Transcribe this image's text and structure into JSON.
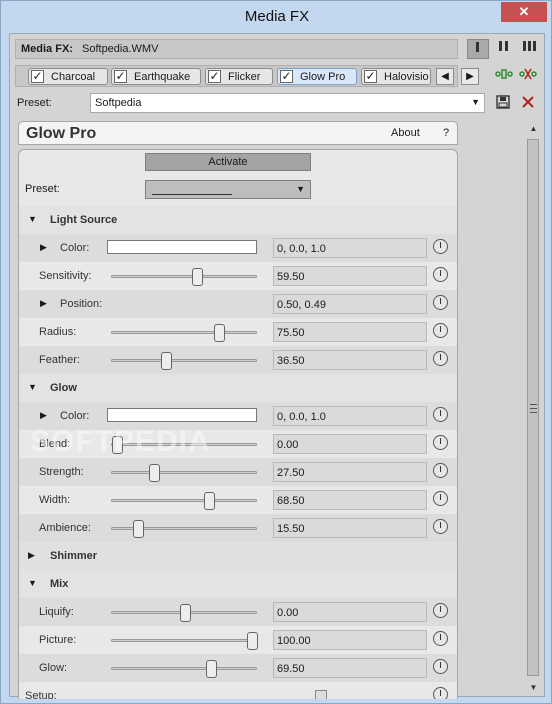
{
  "window": {
    "title": "Media FX",
    "close_glyph": "✕"
  },
  "fx": {
    "label": "Media FX:",
    "value": "Softpedia.WMV"
  },
  "chain": {
    "tabs": [
      {
        "label": "Charcoal",
        "checked": true
      },
      {
        "label": "Earthquake",
        "checked": true
      },
      {
        "label": "Flicker",
        "checked": true
      },
      {
        "label": "Glow Pro",
        "checked": true
      },
      {
        "label": "Halovisio",
        "checked": true
      }
    ],
    "check_glyph": "✓",
    "prev_glyph": "◀",
    "next_glyph": "▶"
  },
  "preset": {
    "label": "Preset:",
    "value": "Softpedia",
    "arrow": "▼"
  },
  "plugin": {
    "name": "Glow Pro",
    "about": "About",
    "help": "?",
    "activate": "Activate",
    "preset_label": "Preset:",
    "preset_arrow": "▼"
  },
  "sections": {
    "light_source": "Light Source",
    "glow": "Glow",
    "shimmer": "Shimmer",
    "mix": "Mix",
    "expanded_glyph": "▼",
    "collapsed_glyph": "▶"
  },
  "params": {
    "ls_color": {
      "label": "Color:",
      "value": "0, 0.0, 1.0"
    },
    "ls_sensitivity": {
      "label": "Sensitivity:",
      "value": "59.50",
      "level": 0.59
    },
    "ls_position": {
      "label": "Position:",
      "value": "0.50, 0.49"
    },
    "ls_radius": {
      "label": "Radius:",
      "value": "75.50",
      "level": 0.755
    },
    "ls_feather": {
      "label": "Feather:",
      "value": "36.50",
      "level": 0.365
    },
    "gl_color": {
      "label": "Color:",
      "value": "0, 0.0, 1.0"
    },
    "gl_blend": {
      "label": "Blend:",
      "value": "0.00",
      "level": 0.0
    },
    "gl_strength": {
      "label": "Strength:",
      "value": "27.50",
      "level": 0.275
    },
    "gl_width": {
      "label": "Width:",
      "value": "68.50",
      "level": 0.685
    },
    "gl_ambience": {
      "label": "Ambience:",
      "value": "15.50",
      "level": 0.155
    },
    "mx_liquify": {
      "label": "Liquify:",
      "value": "0.00",
      "level": 0.5
    },
    "mx_picture": {
      "label": "Picture:",
      "value": "100.00",
      "level": 1.0
    },
    "mx_glow": {
      "label": "Glow:",
      "value": "69.50",
      "level": 0.695
    },
    "mx_setup": {
      "label": "Setup:"
    }
  },
  "watermark": "SOFTPEDIA",
  "colors": {
    "title_bg": "#c3d8ee",
    "close_bg": "#c75050",
    "panel_bg": "#e8e8e8",
    "chain_green": "#2e8b2e",
    "remove_red": "#b22222"
  }
}
